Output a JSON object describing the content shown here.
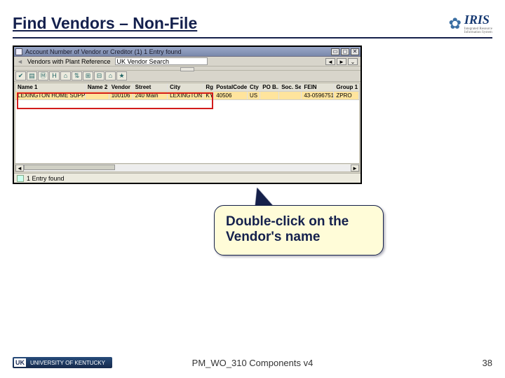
{
  "title": "Find Vendors – Non-File",
  "iris_name": "IRIS",
  "sap": {
    "window_title": "Account Number of Vendor or Creditor (1)    1 Entry found",
    "tab_left": "Vendors with Plant Reference",
    "search_dropdown": "UK Vendor Search",
    "toolbar_icons": [
      "✔",
      "▤",
      "Ⓜ",
      "H",
      "⌂",
      "⇅",
      "⊞",
      "⊟",
      "⌂",
      "★"
    ],
    "columns": [
      "Name 1",
      "Name 2",
      "Vendor",
      "Street",
      "City",
      "Rg",
      "PostalCode",
      "Cty",
      "PO B...",
      "Soc. Se...",
      "FEIN",
      "Group 1"
    ],
    "row": {
      "name1": "LEXINGTON HOME SUPPLY",
      "name2": "",
      "vendor": "100106",
      "street": "240 Main",
      "city": "LEXINGTON",
      "rg": "KY",
      "postal": "40506",
      "cty": "US",
      "pob": "",
      "soc": "",
      "fein": "43-0596751",
      "grp": "ZPRO"
    },
    "status": "1 Entry found"
  },
  "callout_text": "Double-click on the Vendor's name",
  "footer": {
    "uk_initials": "UK",
    "uk_text": "UNIVERSITY OF KENTUCKY",
    "doc": "PM_WO_310 Components v4",
    "page": "38"
  }
}
